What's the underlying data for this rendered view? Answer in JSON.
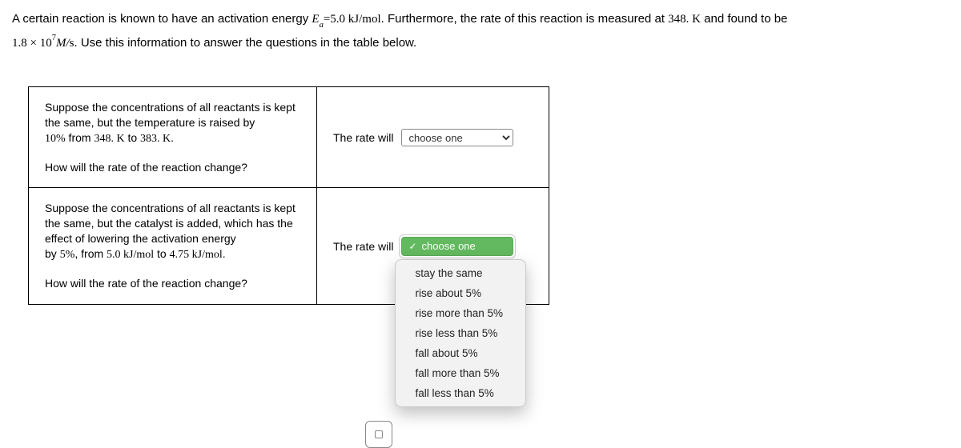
{
  "intro": {
    "part1": "A certain reaction is known to have an activation energy ",
    "Ea_var": "E",
    "Ea_sub": "a",
    "Ea_eq": "=",
    "Ea_val": "5.0",
    "Ea_unit": " kJ/mol",
    "part2": ". Furthermore, the rate of this reaction is measured at ",
    "T_initial": "348. K",
    "part3": " and found to be",
    "rate_coeff": "1.8 × 10",
    "rate_exp": "7",
    "rate_unit_italic": "M/",
    "rate_unit_plain": "s",
    "part4": ". Use this information to answer the questions in the table below."
  },
  "q1": {
    "l1": "Suppose the concentrations of all reactants is kept the same, but the temperature is raised by",
    "l2a": "10%",
    "l2b": " from ",
    "l2c": "348. K",
    "l2d": " to ",
    "l2e": "383. K",
    "l2f": ".",
    "l3": "How will the rate of the reaction change?",
    "answer_prefix": "The rate will",
    "placeholder": "choose one"
  },
  "q2": {
    "l1": "Suppose the concentrations of all reactants is kept the same, but the catalyst is added, which has the effect of lowering the activation energy",
    "l2a": "by ",
    "l2b": "5%",
    "l2c": ", from ",
    "l2d": "5.0",
    "l2e": " kJ/mol",
    "l2f": " to ",
    "l2g": "4.75",
    "l2h": " kJ/mol",
    "l2i": ".",
    "l3": "How will the rate of the reaction change?",
    "answer_prefix": "The rate will",
    "selected": "choose one",
    "options": {
      "o1": "stay the same",
      "o2": "rise about 5%",
      "o3": "rise more than 5%",
      "o4": "rise less than 5%",
      "o5": "fall about 5%",
      "o6": "fall more than 5%",
      "o7": "fall less than 5%"
    }
  }
}
